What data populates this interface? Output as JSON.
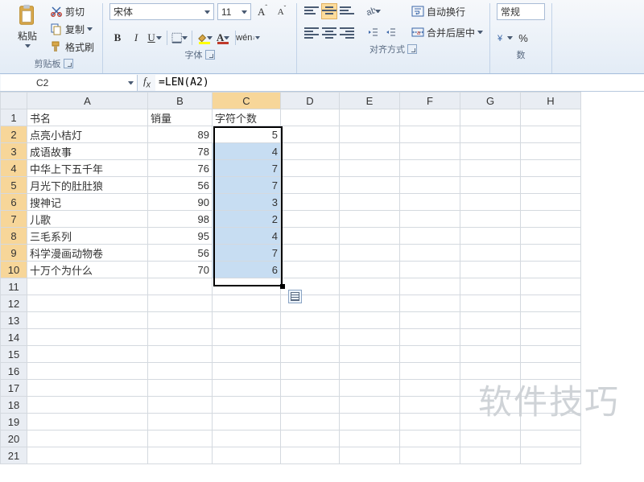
{
  "ribbon": {
    "clipboard": {
      "paste": "粘贴",
      "cut": "剪切",
      "copy": "复制",
      "format_painter": "格式刷",
      "group": "剪贴板"
    },
    "font": {
      "name": "宋体",
      "size": "11",
      "group": "字体"
    },
    "alignment": {
      "wrap": "自动换行",
      "merge": "合并后居中",
      "group": "对齐方式"
    },
    "number": {
      "format": "常规",
      "group": "数"
    }
  },
  "fxbar": {
    "cell": "C2",
    "formula": "=LEN(A2)"
  },
  "cols": [
    "A",
    "B",
    "C",
    "D",
    "E",
    "F",
    "G",
    "H"
  ],
  "headers": {
    "A": "书名",
    "B": "销量",
    "C": "字符个数"
  },
  "rows": [
    {
      "A": "点亮小桔灯",
      "B": 89,
      "C": 5
    },
    {
      "A": "成语故事",
      "B": 78,
      "C": 4
    },
    {
      "A": "中华上下五千年",
      "B": 76,
      "C": 7
    },
    {
      "A": "月光下的肚肚狼",
      "B": 56,
      "C": 7
    },
    {
      "A": "搜神记",
      "B": 90,
      "C": 3
    },
    {
      "A": "儿歌",
      "B": 98,
      "C": 2
    },
    {
      "A": "三毛系列",
      "B": 95,
      "C": 4
    },
    {
      "A": "科学漫画动物卷",
      "B": 56,
      "C": 7
    },
    {
      "A": "十万个为什么",
      "B": 70,
      "C": 6
    }
  ],
  "totalRows": 21,
  "watermark": "软件技巧",
  "selection": {
    "col": "C",
    "start": 2,
    "end": 10
  }
}
